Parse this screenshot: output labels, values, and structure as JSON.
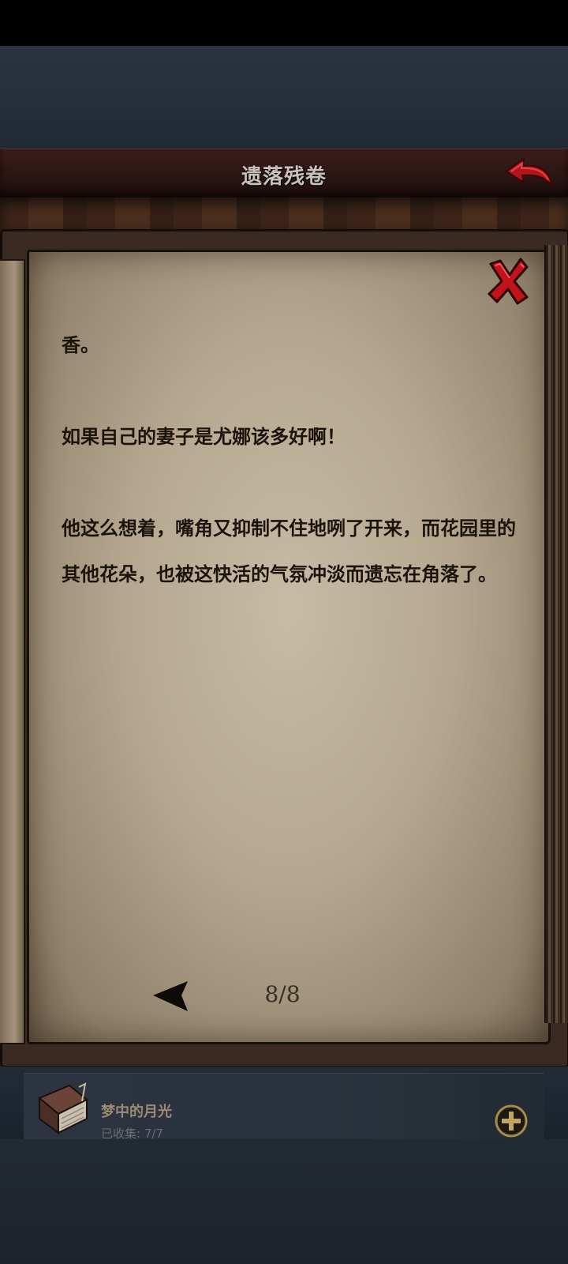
{
  "header": {
    "title": "遗落残卷"
  },
  "reader": {
    "paragraphs": [
      "香。",
      "如果自己的妻子是尤娜该多好啊！",
      "他这么想着，嘴角又抑制不住地咧了开来，而花园里的其他花朵，也被这快活的气氛冲淡而遗忘在角落了。"
    ],
    "page_indicator": "8/8"
  },
  "collection": {
    "name": "梦中的月光",
    "collected": "已收集: 7/7"
  },
  "colors": {
    "close_red": "#c4121a",
    "back_red": "#b3151b",
    "parchment": "#b5a78f",
    "text": "#1c140c"
  },
  "icons": {
    "back": "back-arrow-icon",
    "close": "close-x-icon",
    "prev": "prev-page-arrow-icon",
    "add": "plus-circle-icon",
    "book": "book-icon"
  }
}
